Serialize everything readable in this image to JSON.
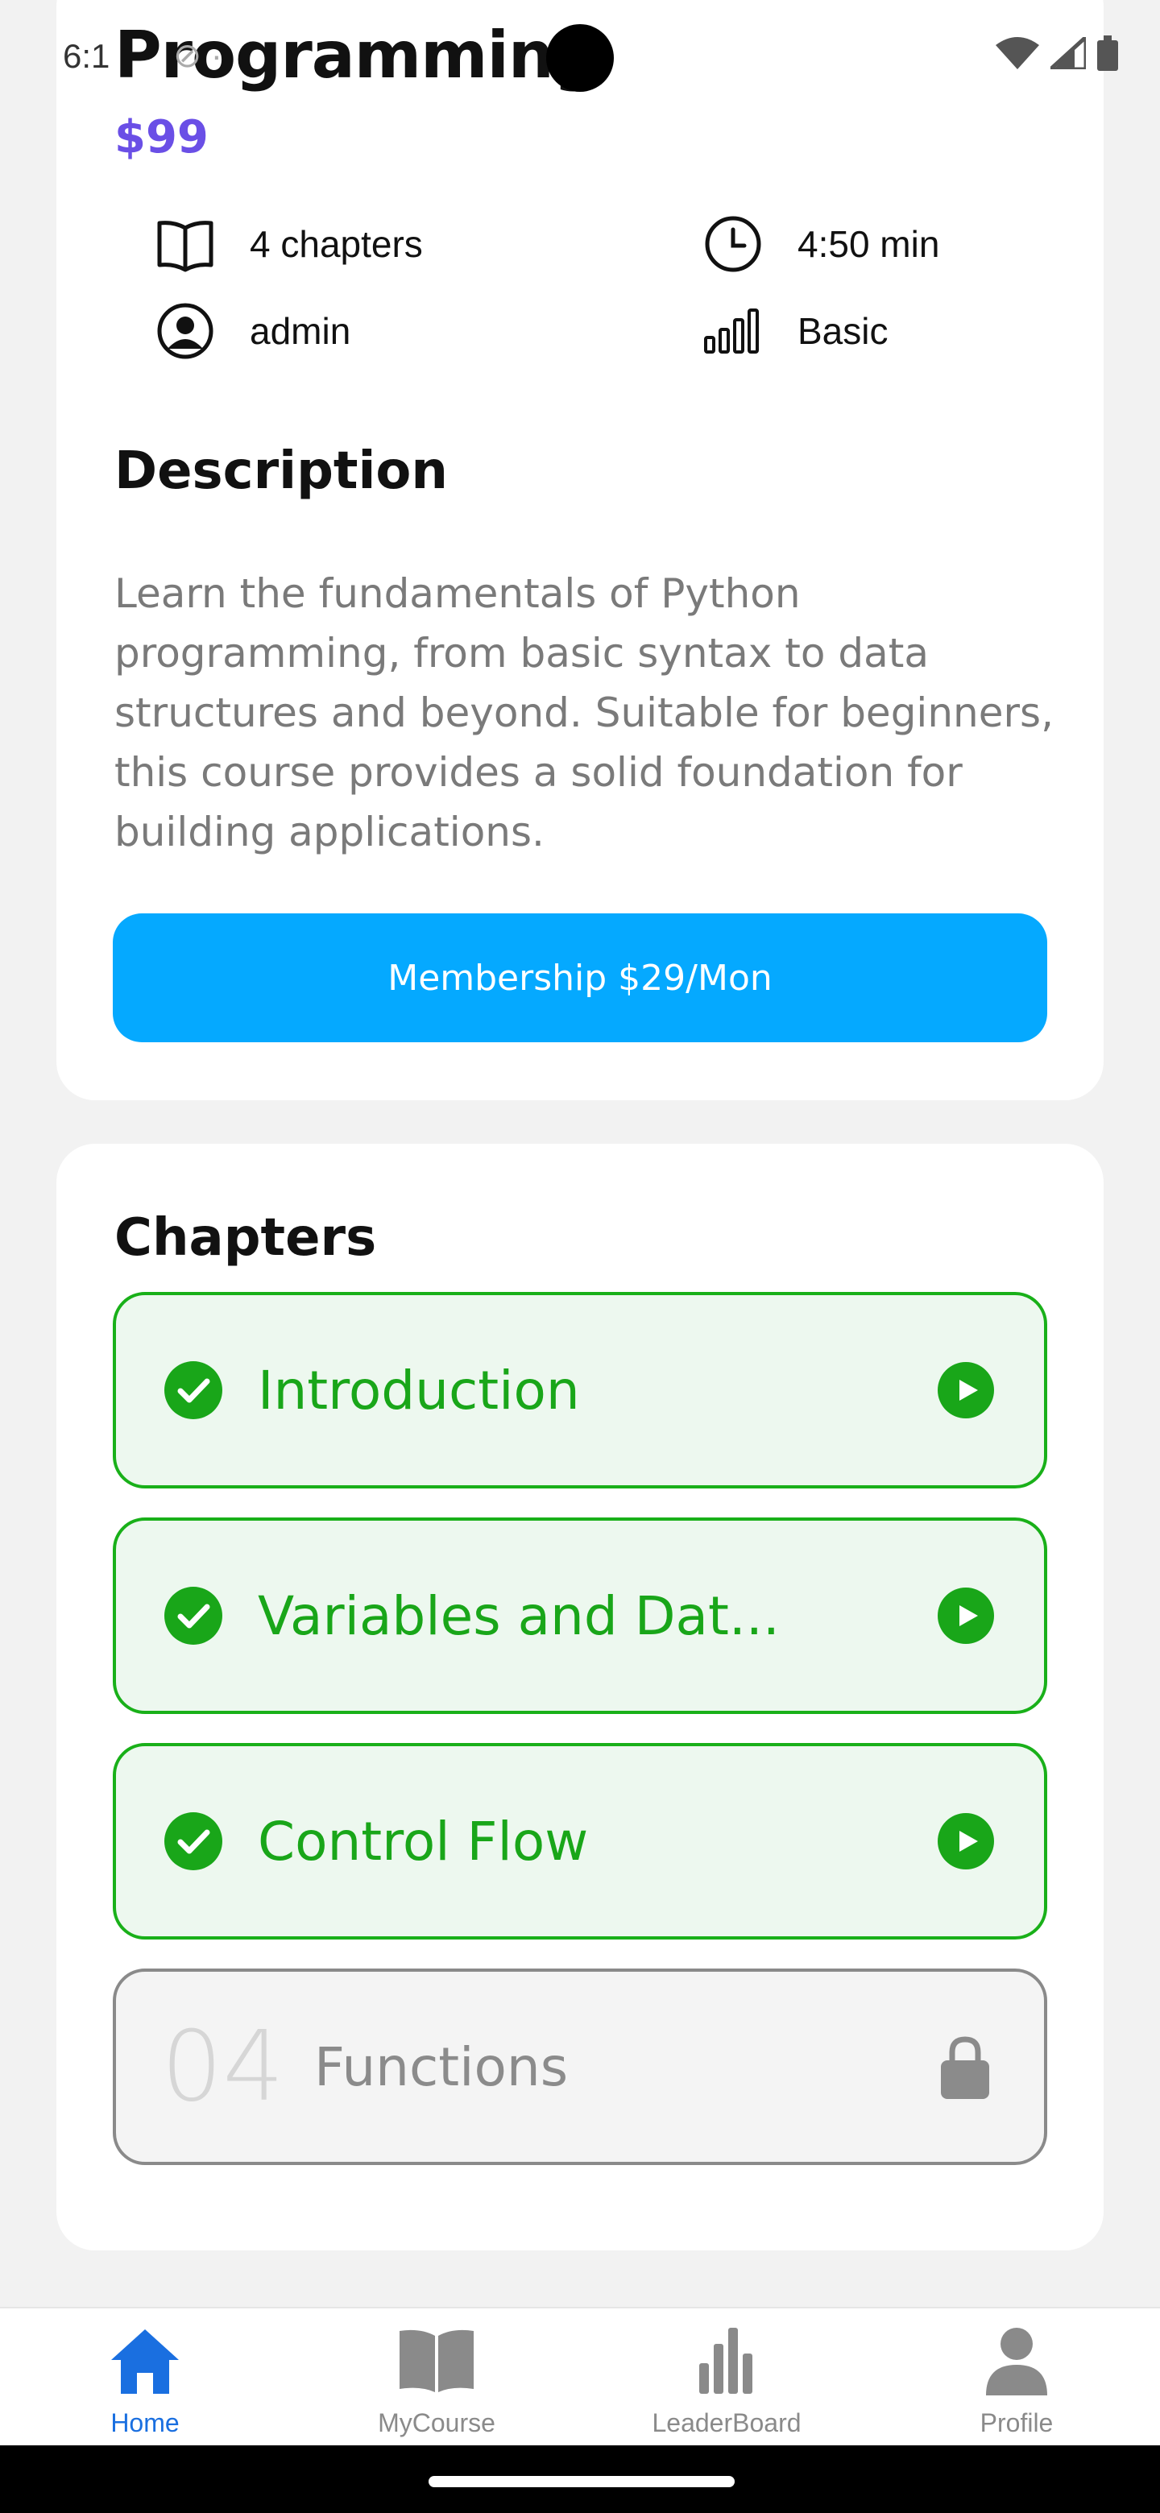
{
  "status_bar": {
    "time": "6:1",
    "misc": "⊘ ·"
  },
  "course": {
    "title": "Programming",
    "price": "$99",
    "meta": {
      "chapters": "4 chapters",
      "duration": "4:50 min",
      "author": "admin",
      "level": "Basic"
    },
    "description_heading": "Description",
    "description": "Learn the fundamentals of Python programming, from basic syntax to data structures and beyond. Suitable for beginners, this course provides a solid foundation for building applications.",
    "membership_button": "Membership $29/Mon"
  },
  "chapters_section": {
    "heading": "Chapters",
    "items": [
      {
        "title": "Introduction",
        "status": "completed"
      },
      {
        "title": "Variables and Dat...",
        "status": "completed"
      },
      {
        "title": "Control Flow",
        "status": "completed"
      },
      {
        "number": "04",
        "title": "Functions",
        "status": "locked"
      }
    ]
  },
  "bottom_nav": {
    "items": [
      {
        "label": "Home",
        "icon": "home-icon",
        "active": true
      },
      {
        "label": "MyCourse",
        "icon": "book-icon",
        "active": false
      },
      {
        "label": "LeaderBoard",
        "icon": "bar-chart-icon",
        "active": false
      },
      {
        "label": "Profile",
        "icon": "person-icon",
        "active": false
      }
    ]
  },
  "colors": {
    "accent_price": "#6a4fe6",
    "membership_button": "#05a9ff",
    "completed_green": "#19b019",
    "nav_active": "#1a6fe0"
  }
}
